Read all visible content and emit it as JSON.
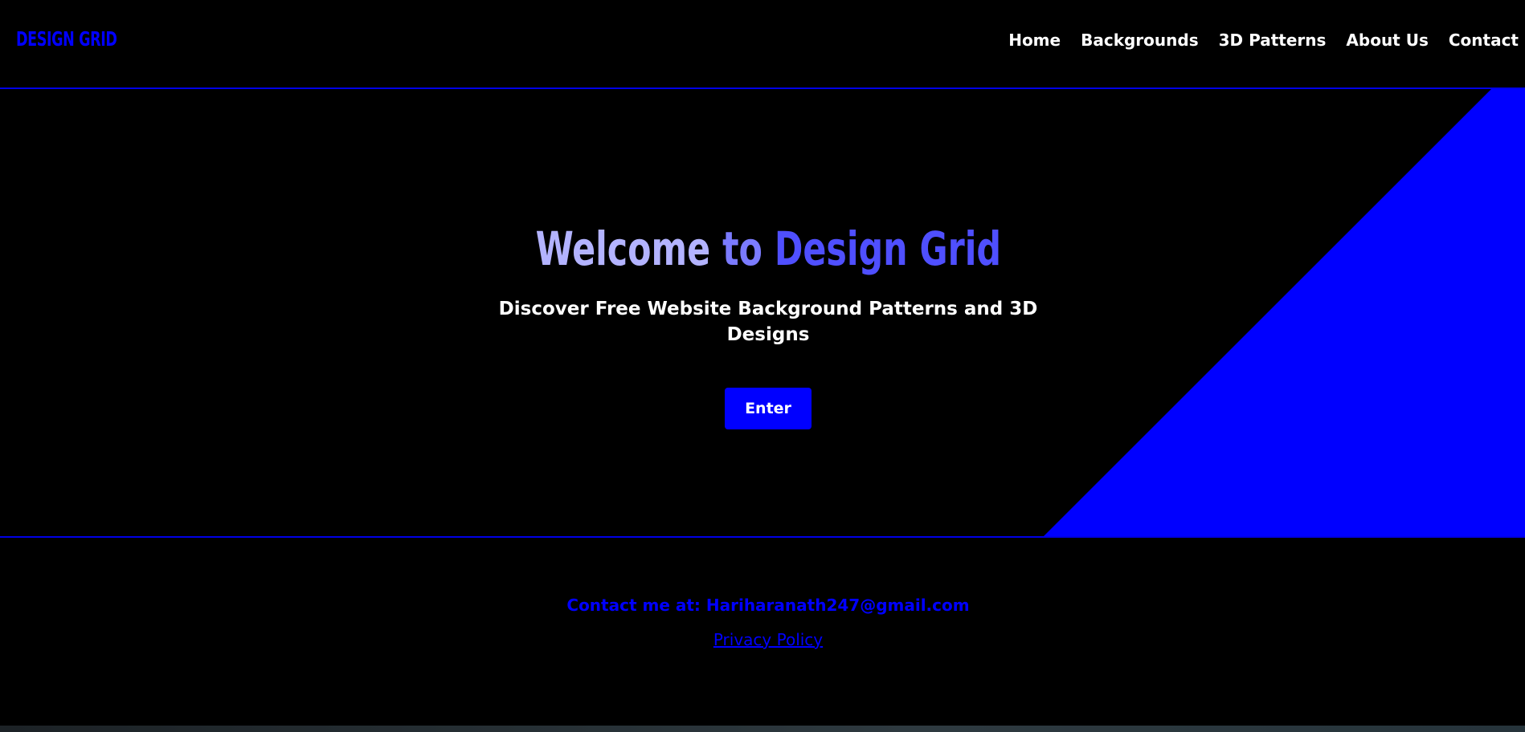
{
  "brand": {
    "logo": "DESIGN GRID"
  },
  "nav": {
    "items": [
      {
        "label": "Home"
      },
      {
        "label": "Backgrounds"
      },
      {
        "label": "3D Patterns"
      },
      {
        "label": "About Us"
      },
      {
        "label": "Contact"
      }
    ]
  },
  "hero": {
    "title_part1": "Welcome ",
    "title_part2": "to ",
    "title_part3": "Design Grid",
    "subtitle": "Discover Free Website Background Patterns and 3D Designs",
    "button_label": "Enter"
  },
  "footer": {
    "contact": "Contact me at: Hariharanath247@gmail.com",
    "privacy_label": "Privacy Policy"
  },
  "colors": {
    "accent": "#0000ff",
    "background": "#000000",
    "text": "#ffffff",
    "title_light": "#b3b3ff",
    "title_mid": "#7b7bff",
    "title_dark": "#4f4fff"
  }
}
